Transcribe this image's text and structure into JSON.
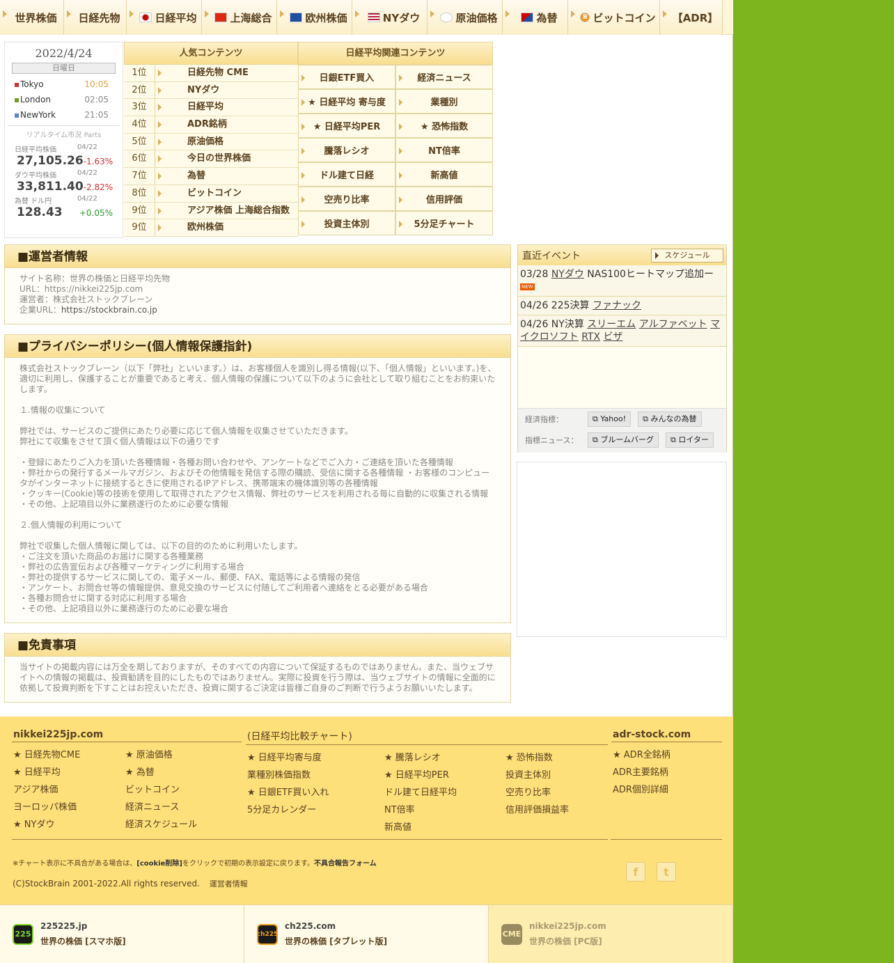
{
  "nav": {
    "items": [
      {
        "label": "世界株価",
        "flag": ""
      },
      {
        "label": "日経先物",
        "flag": ""
      },
      {
        "label": "日経平均",
        "flag": "jp"
      },
      {
        "label": "上海総合",
        "flag": "cn"
      },
      {
        "label": "欧州株価",
        "flag": "eu"
      },
      {
        "label": "NYダウ",
        "flag": "us"
      },
      {
        "label": "原油価格",
        "flag": "oil"
      },
      {
        "label": "為替",
        "flag": "fx"
      },
      {
        "label": "ビットコイン",
        "flag": "btc"
      },
      {
        "label": "【ADR】",
        "flag": ""
      }
    ]
  },
  "clock": {
    "date": "2022/4/24",
    "weekday": "日曜日",
    "cities": [
      {
        "name": "Tokyo",
        "time": "10:05",
        "color": "#d23030",
        "time_color": "#e8a040"
      },
      {
        "name": "London",
        "time": "02:05",
        "color": "#6aa020",
        "time_color": "#888888"
      },
      {
        "name": "NewYork",
        "time": "21:05",
        "color": "#6080d0",
        "time_color": "#888888"
      }
    ],
    "parts_label": "リアルタイム市況 Parts"
  },
  "markets": [
    {
      "name": "日経平均株価",
      "date": "04/22",
      "value": "27,105.26",
      "change": "-1.63%",
      "change_color": "#d23030"
    },
    {
      "name": "ダウ平均株価",
      "date": "04/22",
      "value": "33,811.40",
      "change": "-2.82%",
      "change_color": "#d23030"
    },
    {
      "name": "為替 ドル円",
      "date": "04/22",
      "value": "128.43",
      "change": "+0.05%",
      "change_color": "#2a9a2a"
    }
  ],
  "popular": {
    "title": "人気コンテンツ",
    "rows": [
      {
        "rank": "1位",
        "label": "日経先物 CME"
      },
      {
        "rank": "2位",
        "label": "NYダウ"
      },
      {
        "rank": "3位",
        "label": "日経平均"
      },
      {
        "rank": "4位",
        "label": "ADR銘柄"
      },
      {
        "rank": "5位",
        "label": "原油価格"
      },
      {
        "rank": "6位",
        "label": "今日の世界株価"
      },
      {
        "rank": "7位",
        "label": "為替"
      },
      {
        "rank": "8位",
        "label": "ビットコイン"
      },
      {
        "rank": "9位",
        "label": "アジア株価 上海総合指数"
      },
      {
        "rank": "9位",
        "label": "欧州株価"
      }
    ]
  },
  "related": {
    "title": "日経平均関連コンテンツ",
    "cells": [
      "日銀ETF買入",
      "経済ニュース",
      "★ 日経平均 寄与度",
      "業種別",
      "★ 日経平均PER",
      "★ 恐怖指数",
      "騰落レシオ",
      "NT倍率",
      "ドル建て日経",
      "新高値",
      "空売り比率",
      "信用評価",
      "投資主体別",
      "5分足チャート"
    ]
  },
  "operator": {
    "title": "■運営者情報",
    "site_name": "サイト名称：世界の株価と日経平均先物",
    "url": "URL：https://nikkei225jp.com",
    "company": "運営者：株式会社ストックブレーン",
    "corp_url_label": "企業URL：",
    "corp_url": "https://stockbrain.co.jp"
  },
  "privacy": {
    "title": "■プライバシーポリシー(個人情報保護指針)",
    "body": "株式会社ストックブレーン（以下「弊社」といいます。）は、お客様個人を識別し得る情報(以下、「個人情報」といいます。)を、適切に利用し、保護することが重要であると考え、個人情報の保護について以下のように会社として取り組むことをお約束いたします。\n\n１.情報の収集について\n\n弊社では、サービスのご提供にあたり必要に応じて個人情報を収集させていただきます。\n弊社にて収集をさせて頂く個人情報は以下の通りです\n\n・登録にあたりご入力を頂いた各種情報・各種お問い合わせや、アンケートなどでご入力・ご連絡を頂いた各種情報\n・弊社からの発行するメールマガジン、およびその他情報を発信する際の購読、受信に関する各種情報 ・お客様のコンピュータがインターネットに接続するときに使用されるIPアドレス、携帯端末の機体識別等の各種情報\n・クッキー(Cookie)等の技術を使用して取得されたアクセス情報、弊社のサービスを利用される毎に自動的に収集される情報\n・その他、上記項目以外に業務遂行のために必要な情報\n\n２.個人情報の利用について\n\n弊社で収集した個人情報に関しては、以下の目的のために利用いたします。\n・ご注文を頂いた商品のお届けに関する各種業務\n・弊社の広告宣伝および各種マーケティングに利用する場合\n・弊社の提供するサービスに関しての、電子メール、郵便、FAX、電話等による情報の発信\n・アンケート、お問合せ等の情報提供、意見交換のサービスに付随してご利用者へ連絡をとる必要がある場合\n・各種お問合せに関する対応に利用する場合\n・その他、上記項目以外に業務遂行のために必要な場合"
  },
  "disclaimer": {
    "title": "■免責事項",
    "body": "当サイトの掲載内容には万全を期しておりますが、そのすべての内容について保証するものではありません。また、当ウェブサイトへの情報の掲載は、投資勧誘を目的にしたものではありません。実際に投資を行う際は、当ウェブサイトの情報に全面的に依拠して投資判断を下すことはお控えいただき、投資に関するご決定は皆様ご自身のご判断で行うようお願いいたします。"
  },
  "events": {
    "title": "直近イベント",
    "schedule_label": "スケジュール",
    "row1": {
      "date": "03/28",
      "link": "NYダウ",
      "text": "NAS100ヒートマップ追加ー",
      "badge": "NEW"
    },
    "row2": {
      "prefix": "04/26 225決算",
      "link": "ファナック"
    },
    "row3": {
      "prefix": "04/26 NY決算",
      "links": [
        "スリーエム",
        "アルファベット",
        "マイクロソフト",
        "RTX",
        "ビザ"
      ]
    },
    "indicator_label": "経済指標：",
    "indicator_links": [
      "Yahoo!",
      "みんなの為替"
    ],
    "news_label": "指標ニュース：",
    "news_links": [
      "ブルームバーグ",
      "ロイター"
    ]
  },
  "footer": {
    "col1": {
      "title": "nikkei225jp.com",
      "items": [
        "★ 日経先物CME",
        "★ 原油価格",
        "★ 日経平均",
        "★ 為替",
        "アジア株価",
        "ビットコイン",
        "ヨーロッパ株価",
        "経済ニュース",
        "★ NYダウ",
        "経済スケジュール"
      ]
    },
    "col2": {
      "title": "(日経平均比較チャート)",
      "items": [
        "★ 日経平均寄与度",
        "★ 騰落レシオ",
        "★ 恐怖指数",
        "業種別株価指数",
        "★ 日経平均PER",
        "投資主体別",
        "★ 日銀ETF買い入れ",
        "ドル建て日経平均",
        "空売り比率",
        "5分足カレンダー",
        "NT倍率",
        "信用評価損益率",
        "",
        "新高値",
        ""
      ]
    },
    "col3": {
      "title": "adr-stock.com",
      "items": [
        "★ ADR全銘柄",
        "ADR主要銘柄",
        "ADR個別詳細"
      ]
    },
    "note_prefix": "※チャート表示に不具合がある場合は、",
    "note_cookie": "[cookie削除]",
    "note_mid": "をクリックで初期の表示設定に戻ります。",
    "note_form": "不具合報告フォーム",
    "copyright": "(C)StockBrain 2001-2022.All rights reserved.",
    "operator_link": "運営者情報",
    "facebook_glyph": "f",
    "twitter_glyph": "t"
  },
  "bottom": [
    {
      "site": "225225.jp",
      "desc": "世界の株価 [スマホ版]",
      "logo": "225",
      "logo_bg": "#1a1a1a",
      "logo_fg": "#7fdc2a",
      "inactive": false
    },
    {
      "site": "ch225.com",
      "desc": "世界の株価 [タブレット版]",
      "logo": "ch225",
      "logo_bg": "#1a1a1a",
      "logo_fg": "#f0a020",
      "inactive": false
    },
    {
      "site": "nikkei225jp.com",
      "desc": "世界の株価 [PC版]",
      "logo": "CME",
      "logo_bg": "#9a8a60",
      "logo_fg": "#fdeeb0",
      "inactive": true
    }
  ]
}
